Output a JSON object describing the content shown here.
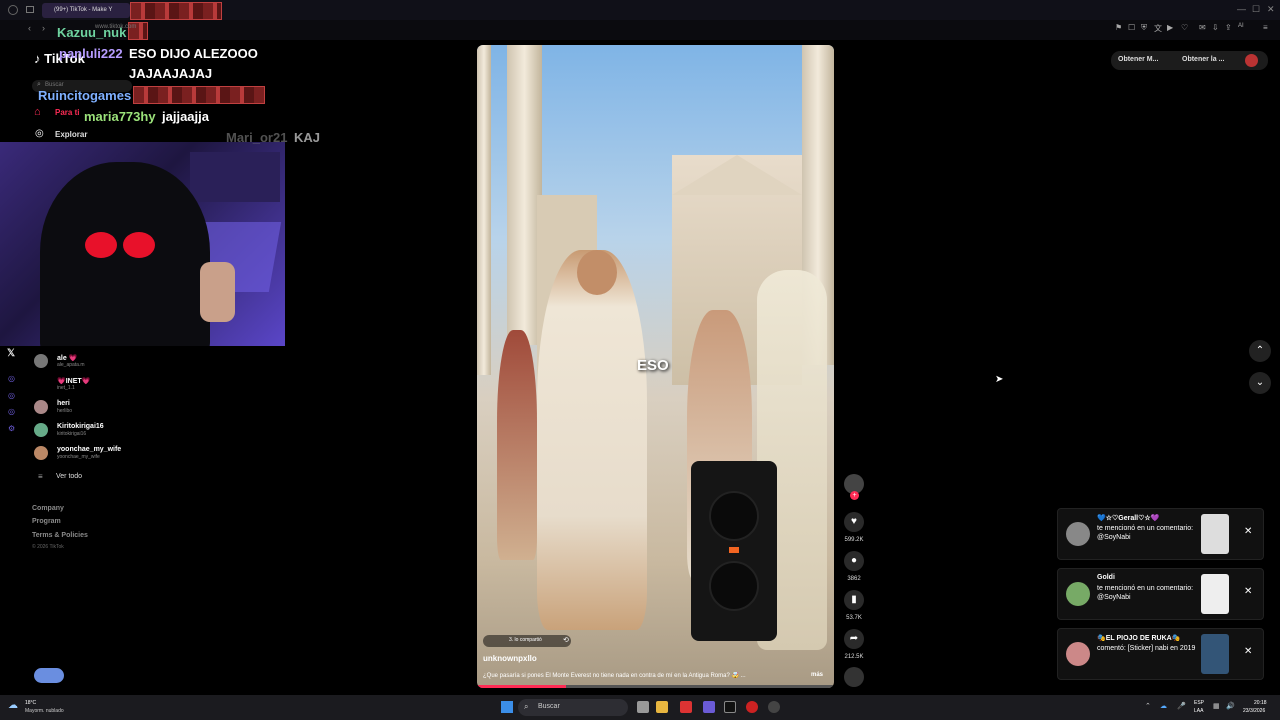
{
  "browser": {
    "tab_title": "(99+) TikTok - Make Y",
    "url": "www.tiktok.com",
    "toolbar_ai": "AI",
    "get_label_1": "Obtener M...",
    "get_label_2": "Obtener la ..."
  },
  "tiktok": {
    "logo": "TikTok",
    "search_placeholder": "Buscar",
    "nav": [
      {
        "label": "Para ti",
        "icon": "home-icon"
      },
      {
        "label": "Explorar",
        "icon": "compass-icon"
      }
    ],
    "following": [
      {
        "name": "ale 💗",
        "handle": "ale_apata.m"
      },
      {
        "name": "💗INET💗",
        "handle": "inet_1.1"
      },
      {
        "name": "heri",
        "handle": "herlibo"
      },
      {
        "name": "Kiritokirigai16",
        "handle": "kiritokirigai16"
      },
      {
        "name": "yoonchae_my_wife",
        "handle": "yoonchae_my_wife"
      }
    ],
    "see_all": "Ver todo",
    "footer": [
      "Company",
      "Program",
      "Terms & Policies",
      "© 2026 TikTok"
    ]
  },
  "chat": [
    {
      "user": "Kazuu_nuk",
      "message": "",
      "color": "#6fd3a0"
    },
    {
      "user": "panluli222",
      "message": "ESO DIJO ALEZOOO",
      "color": "#b69cff"
    },
    {
      "user": "",
      "message": "JAJAAJAJAJ",
      "color": "#ffffff"
    },
    {
      "user": "Ruincitogames",
      "message": "",
      "color": "#7fb0ff"
    },
    {
      "user": "maria773hy",
      "message": "jajjaajja",
      "color": "#9be27a"
    },
    {
      "user": "Mari_or21",
      "message": "KAJ",
      "color": "#888888"
    }
  ],
  "video": {
    "caption_overlay": "ESO",
    "shared_by": "3. lo compartió",
    "author": "unknownpxllo",
    "description": "¿Que pasaría si pones El Monte Everest no tiene nada en contra de mí en la Antigua Roma? 🤯 ...",
    "more": "más",
    "progress": 0.25
  },
  "actions": {
    "likes": "599.2K",
    "comments": "3862",
    "saves": "53.7K",
    "shares": "212.5K"
  },
  "notifications": [
    {
      "title": "💙☆♡Gerall♡☆💜",
      "body": "te mencionó en un comentario: @SoyNabi"
    },
    {
      "title": "Goldi",
      "body": "te mencionó en un comentario: @SoyNabi"
    },
    {
      "title": "🎭EL PIOJO DE RUKA🎭",
      "body": "comentó: [Sticker] nabi en 2019"
    }
  ],
  "taskbar": {
    "weather_temp": "18°C",
    "weather_desc": "Mayorm. nublado",
    "search": "Buscar",
    "lang": "ESP",
    "lang2": "LAA",
    "time": "20:18",
    "date": "23/3/2026"
  }
}
